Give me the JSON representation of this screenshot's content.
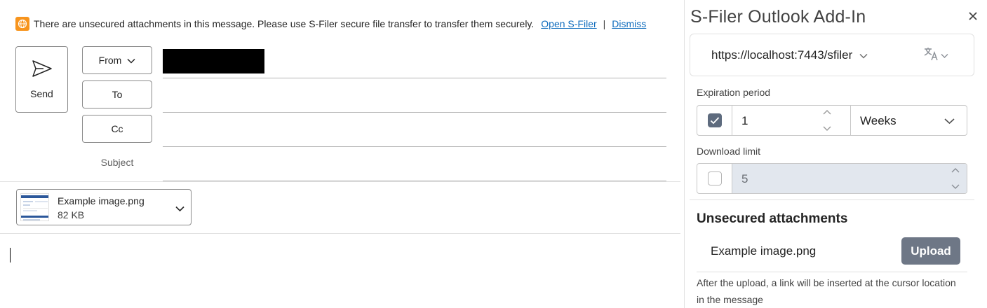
{
  "compose": {
    "infobar": {
      "icon": "globe-warning-icon",
      "message": "There are unsecured attachments in this message. Please use S-Filer secure file transfer to transfer them securely.",
      "open_link": "Open S-Filer",
      "separator": "|",
      "dismiss_link": "Dismiss"
    },
    "send_label": "Send",
    "from_label": "From",
    "to_label": "To",
    "cc_label": "Cc",
    "subject_label": "Subject",
    "to_value": "",
    "cc_value": "",
    "subject_value": "",
    "attachment": {
      "name": "Example image.png",
      "size": "82 KB"
    }
  },
  "addin": {
    "title": "S-Filer Outlook Add-In",
    "server_url": "https://localhost:7443/sfiler",
    "expiration_label": "Expiration period",
    "expiration_enabled": true,
    "expiration_value": "1",
    "expiration_unit": "Weeks",
    "download_label": "Download limit",
    "download_enabled": false,
    "download_value": "5",
    "unsecured_heading": "Unsecured attachments",
    "unsecured_items": [
      {
        "name": "Example image.png",
        "action": "Upload"
      }
    ],
    "helper_text": "After the upload, a link will be inserted at the cursor location in the message"
  },
  "colors": {
    "link": "#0f6cbd",
    "warning_icon": "#f7941d",
    "checkbox_on": "#5e6b7e",
    "upload_button": "#6e7786",
    "disabled_field": "#e2e7ee"
  }
}
